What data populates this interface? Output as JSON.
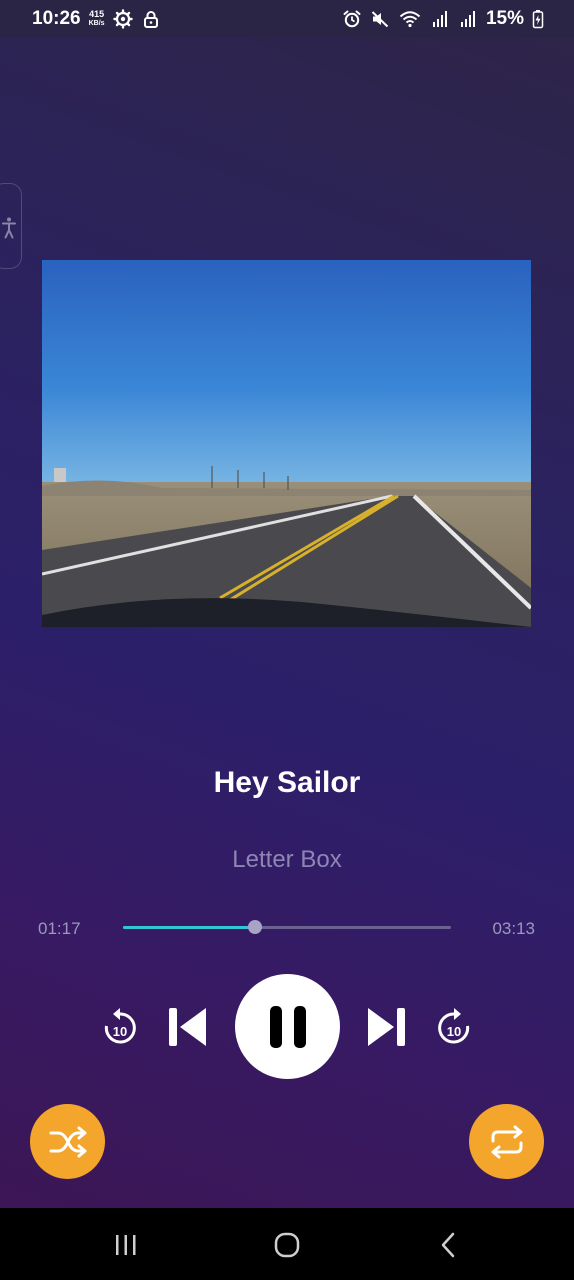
{
  "status_bar": {
    "time": "10:26",
    "speed_value": "415",
    "speed_unit": "KB/s",
    "battery": "15%",
    "icons": [
      "settings-gear-icon",
      "lock-icon",
      "alarm-icon",
      "mute-icon",
      "wifi-icon",
      "signal-icon",
      "signal-icon",
      "battery-charging-icon"
    ]
  },
  "player": {
    "song_title": "Hey Sailor",
    "artist": "Letter Box",
    "elapsed": "01:17",
    "duration": "03:13",
    "progress_fraction": 0.403,
    "rewind_seconds": "10",
    "forward_seconds": "10",
    "state": "playing"
  },
  "colors": {
    "accent_progress": "#32c6d8",
    "action_buttons": "#f3a52c",
    "background_top": "#2e2547",
    "background_bottom": "#3d1552"
  },
  "nav_bar": {
    "icons": [
      "recents-icon",
      "home-icon",
      "back-icon"
    ]
  }
}
